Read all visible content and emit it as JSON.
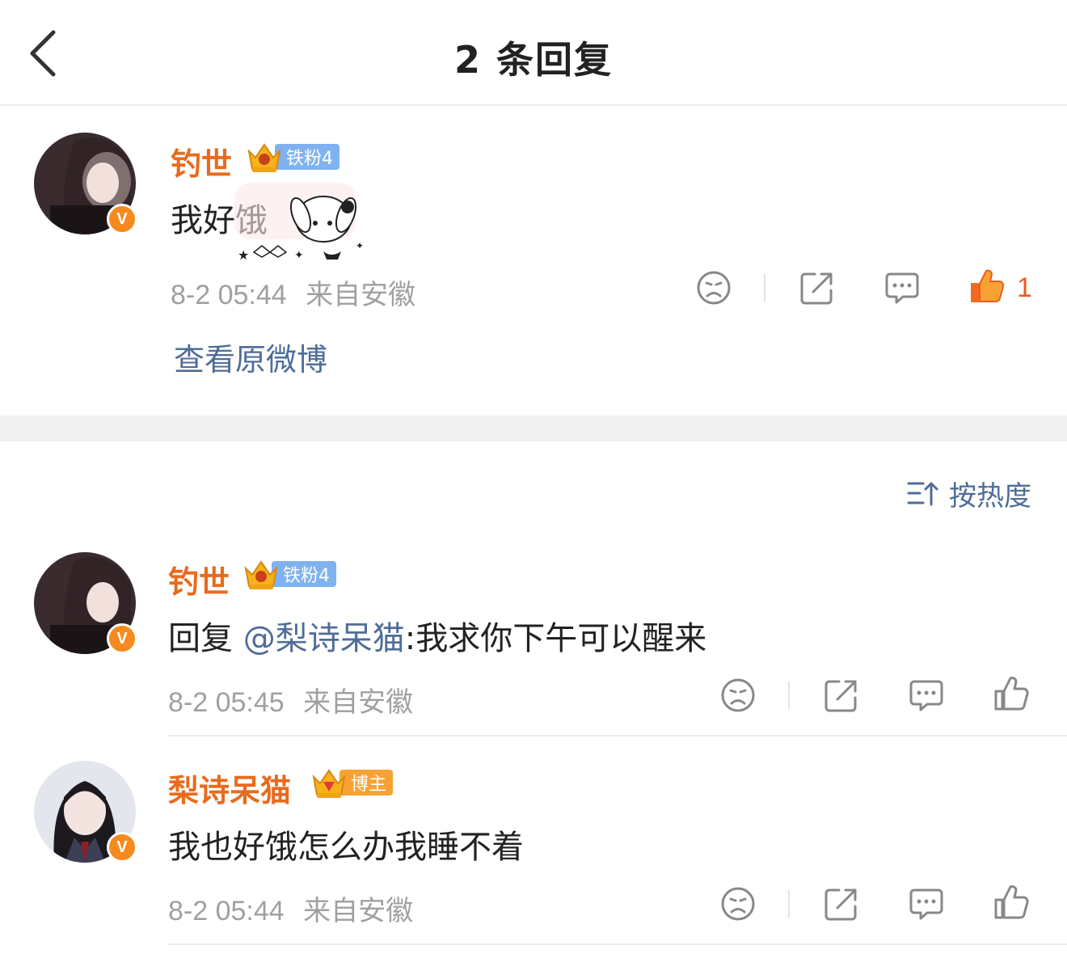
{
  "header": {
    "title": "2 条回复",
    "back_icon": "chevron-left-icon"
  },
  "root_comment": {
    "username": "钓世",
    "badge_label": "铁粉4",
    "avatar_badge": "V",
    "text": "我好饿",
    "sticker": "sticker-bunny",
    "time": "8-2 05:44",
    "source": "来自安徽",
    "like_count": "1",
    "liked": true,
    "view_original": "查看原微博"
  },
  "sort": {
    "label": "按热度",
    "icon": "sort-icon"
  },
  "replies": [
    {
      "username": "钓世",
      "badge_label": "铁粉4",
      "avatar_badge": "V",
      "reply_prefix": "回复",
      "mention": "@梨诗呆猫",
      "text": ":我求你下午可以醒来",
      "time": "8-2 05:45",
      "source": "来自安徽"
    },
    {
      "username": "梨诗呆猫",
      "badge_label": "博主",
      "avatar_badge": "V",
      "text": "我也好饿怎么办我睡不着",
      "time": "8-2 05:44",
      "source": "来自安徽"
    }
  ],
  "colors": {
    "username": "#e86b1d",
    "link": "#4f6d98",
    "meta": "#a0a0a0",
    "like_active": "#ec5c24",
    "fan_badge": "#7fb2f0",
    "owner_badge": "#f7a233",
    "verified": "#f58a1f"
  }
}
